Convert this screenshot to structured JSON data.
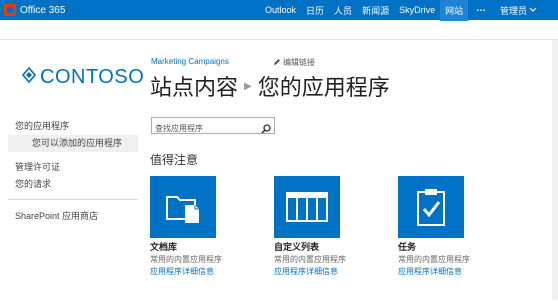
{
  "suite": {
    "brand": "Office 365",
    "nav": [
      "Outlook",
      "日历",
      "人员",
      "新闻源",
      "SkyDrive",
      "网站"
    ],
    "active_index": 5,
    "more": "…",
    "user": "管理员"
  },
  "logo": {
    "text": "CONTOSO"
  },
  "leftnav": {
    "your_apps": "您的应用程序",
    "apps_you_can_add": "您可以添加的应用程序",
    "manage_licenses": "管理许可证",
    "your_requests": "您的请求",
    "store": "SharePoint 应用商店"
  },
  "header": {
    "site": "Marketing Campaigns",
    "edit_links": "编辑链接",
    "crumb_root": "站点内容",
    "crumb_page": "您的应用程序"
  },
  "search": {
    "placeholder": "查找应用程序"
  },
  "noteworthy": "值得注意",
  "tiles": [
    {
      "name": "文档库",
      "desc": "常用的内置应用程序",
      "link": "应用程序详细信息",
      "icon": "document-library-icon"
    },
    {
      "name": "自定义列表",
      "desc": "常用的内置应用程序",
      "link": "应用程序详细信息",
      "icon": "custom-list-icon"
    },
    {
      "name": "任务",
      "desc": "常用的内置应用程序",
      "link": "应用程序详细信息",
      "icon": "tasks-icon"
    }
  ],
  "colors": {
    "suite_bar": "#0072c6",
    "accent": "#0072c6"
  }
}
